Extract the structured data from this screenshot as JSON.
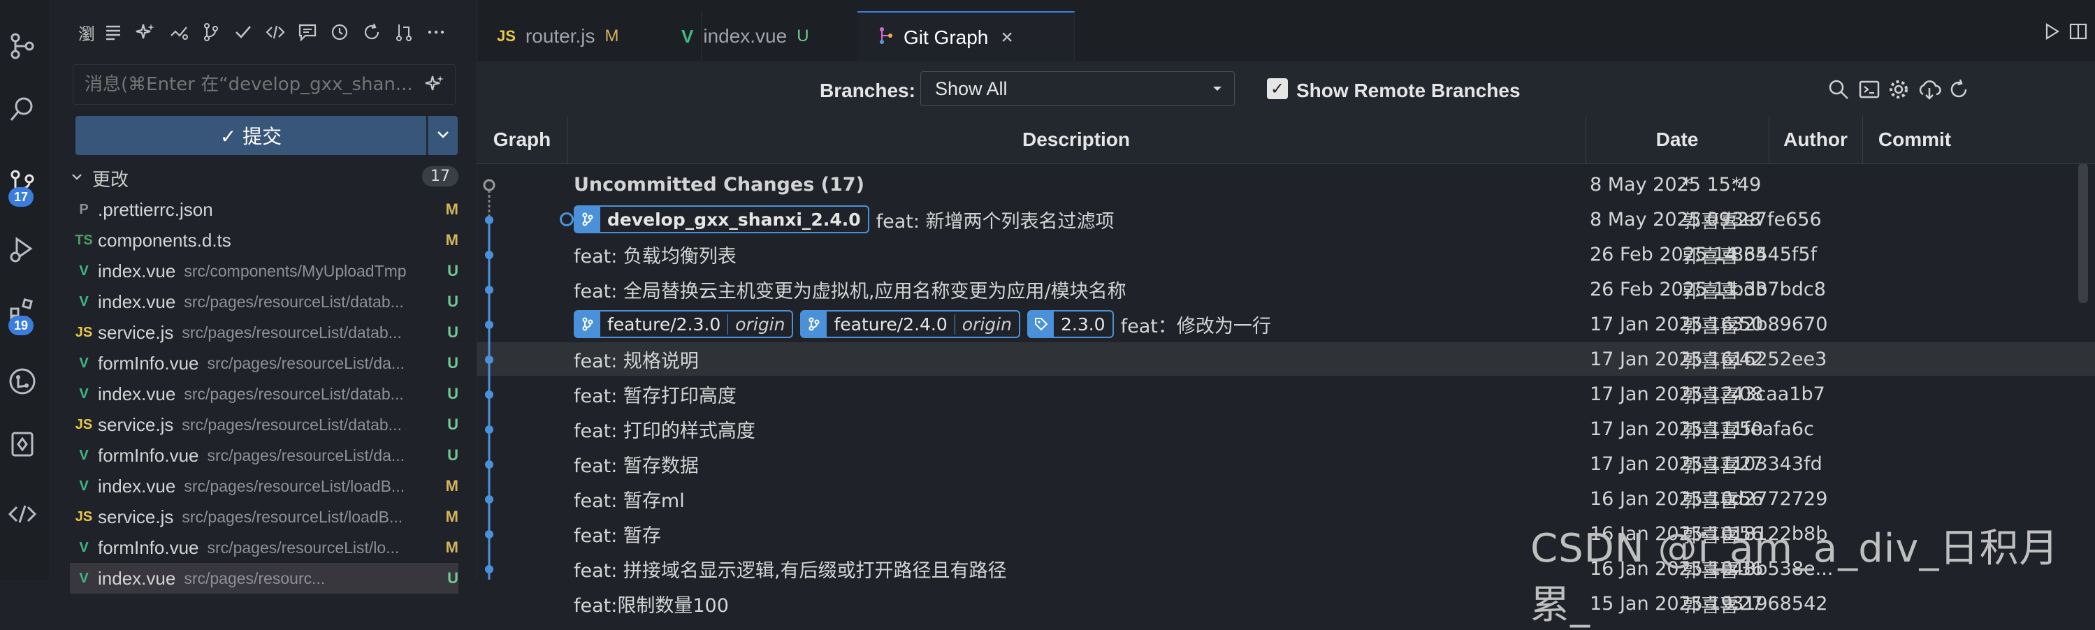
{
  "activity_bar": {
    "scm_badge": "17",
    "extensions_badge": "19",
    "icons": [
      "source-control-graph-icon",
      "search-icon",
      "source-control-icon",
      "run-debug-icon",
      "extensions-icon",
      "git-lens-icon",
      "remote-explorer-icon",
      "gitgraph-code-icon"
    ]
  },
  "scm": {
    "toolbar_icons": [
      "sparkle-icon",
      "list-icon",
      "sparkle-icon",
      "commit-icon",
      "branch-icon",
      "check-icon",
      "code-icon",
      "comment-icon",
      "history-icon",
      "refresh-icon",
      "pull-request-icon",
      "more-icon"
    ],
    "toolbar_first_char": "瀏",
    "message_placeholder": "消息(⌘Enter 在“develop_gxx_shan...",
    "commit_label": "✓ 提交",
    "changes_label": "更改",
    "changes_count": "17",
    "files": [
      {
        "icon": "P",
        "icon_color": "#8d9197",
        "name": ".prettierrc.json",
        "path": "",
        "status": "M"
      },
      {
        "icon": "TS",
        "icon_color": "#4e9f66",
        "name": "components.d.ts",
        "path": "",
        "status": "M"
      },
      {
        "icon": "V",
        "icon_color": "#41b883",
        "name": "index.vue",
        "path": "src/components/MyUploadTmp",
        "status": "U"
      },
      {
        "icon": "V",
        "icon_color": "#41b883",
        "name": "index.vue",
        "path": "src/pages/resourceList/datab...",
        "status": "U"
      },
      {
        "icon": "JS",
        "icon_color": "#e8c84a",
        "name": "service.js",
        "path": "src/pages/resourceList/datab...",
        "status": "U"
      },
      {
        "icon": "V",
        "icon_color": "#41b883",
        "name": "formInfo.vue",
        "path": "src/pages/resourceList/da...",
        "status": "U"
      },
      {
        "icon": "V",
        "icon_color": "#41b883",
        "name": "index.vue",
        "path": "src/pages/resourceList/datab...",
        "status": "U"
      },
      {
        "icon": "JS",
        "icon_color": "#e8c84a",
        "name": "service.js",
        "path": "src/pages/resourceList/datab...",
        "status": "U"
      },
      {
        "icon": "V",
        "icon_color": "#41b883",
        "name": "formInfo.vue",
        "path": "src/pages/resourceList/da...",
        "status": "U"
      },
      {
        "icon": "V",
        "icon_color": "#41b883",
        "name": "index.vue",
        "path": "src/pages/resourceList/loadB...",
        "status": "M"
      },
      {
        "icon": "JS",
        "icon_color": "#e8c84a",
        "name": "service.js",
        "path": "src/pages/resourceList/loadB...",
        "status": "M"
      },
      {
        "icon": "V",
        "icon_color": "#41b883",
        "name": "formInfo.vue",
        "path": "src/pages/resourceList/lo...",
        "status": "M"
      },
      {
        "icon": "V",
        "icon_color": "#41b883",
        "name": "index.vue",
        "path": "src/pages/resourc...",
        "status": "U"
      }
    ]
  },
  "tabs": [
    {
      "icon": "JS",
      "icon_color": "#e8c84a",
      "label": "router.js",
      "mod": "M",
      "mod_color": "#d6b45c"
    },
    {
      "icon": "V",
      "icon_color": "#41b883",
      "label": "index.vue",
      "mod": "U",
      "mod_color": "#73c991"
    },
    {
      "icon": "git-graph-icon",
      "icon_color": "#d06bd4",
      "label": "Git Graph",
      "mod": "×",
      "mod_color": "#cccccc"
    }
  ],
  "git_graph": {
    "branches_label": "Branches:",
    "branches_value": "Show All",
    "show_remote_label": "Show Remote Branches",
    "show_remote_checked": true,
    "columns": [
      "Graph",
      "Description",
      "Date",
      "Author",
      "Commit"
    ],
    "rows": [
      {
        "desc": "Uncommitted Changes (17)",
        "bold": true,
        "refs": [],
        "date": "8 May 2025 15:49",
        "author": "*",
        "commit": "*"
      },
      {
        "desc": "feat: 新增两个列表名过滤项",
        "refs": [
          {
            "type": "head",
            "name": "develop_gxx_shanxi_2.4.0"
          }
        ],
        "date": "8 May 2025 09:28",
        "author": "郭喜喜",
        "commit": "3e7fe656"
      },
      {
        "desc": "feat: 负载均衡列表",
        "refs": [],
        "date": "26 Feb 2025 14:34",
        "author": "郭喜喜",
        "commit": "86545f5f"
      },
      {
        "desc": "feat: 全局替换云主机变更为虚拟机,应用名称变更为应用/模块名称",
        "refs": [],
        "date": "26 Feb 2025 11:33",
        "author": "郭喜喜",
        "commit": "bdb7bdc8"
      },
      {
        "desc": "feat：修改为一行",
        "refs": [
          {
            "type": "branch",
            "name": "feature/2.3.0",
            "remote": "origin"
          },
          {
            "type": "branch",
            "name": "feature/2.4.0",
            "remote": "origin"
          },
          {
            "type": "tag",
            "name": "2.3.0"
          }
        ],
        "date": "17 Jan 2025 16:50",
        "author": "郭喜喜",
        "commit": "32b89670"
      },
      {
        "desc": "feat: 规格说明",
        "refs": [],
        "date": "17 Jan 2025 16:42",
        "author": "郭喜喜",
        "commit": "16252ee3",
        "highlight": true
      },
      {
        "desc": "feat: 暂存打印高度",
        "refs": [],
        "date": "17 Jan 2025 12:08",
        "author": "郭喜喜",
        "commit": "43caa1b7"
      },
      {
        "desc": "feat: 打印的样式高度",
        "refs": [],
        "date": "17 Jan 2025 11:50",
        "author": "郭喜喜",
        "commit": "1feafa6c"
      },
      {
        "desc": "feat: 暂存数据",
        "refs": [],
        "date": "17 Jan 2025 11:27",
        "author": "郭喜喜",
        "commit": "103343fd"
      },
      {
        "desc": "feat: 暂存ml",
        "refs": [],
        "date": "16 Jan 2025 10:56",
        "author": "郭喜喜",
        "commit": "d2772729"
      },
      {
        "desc": "feat: 暂存",
        "refs": [],
        "date": "16 Jan 2025 10:56",
        "author": "郭喜喜",
        "commit": "18122b8b"
      },
      {
        "desc": "feat: 拼接域名显示逻辑,有后缀或打开路径且有路径",
        "refs": [],
        "date": "16 Jan 2025 10:36",
        "author": "郭喜喜",
        "commit": "48b538e..."
      },
      {
        "desc": "feat:限制数量100",
        "refs": [],
        "date": "15 Jan 2025 19:27",
        "author": "郭喜喜",
        "commit": "31968542"
      }
    ]
  },
  "watermark": "CSDN @i_am_a_div_日积月累_"
}
